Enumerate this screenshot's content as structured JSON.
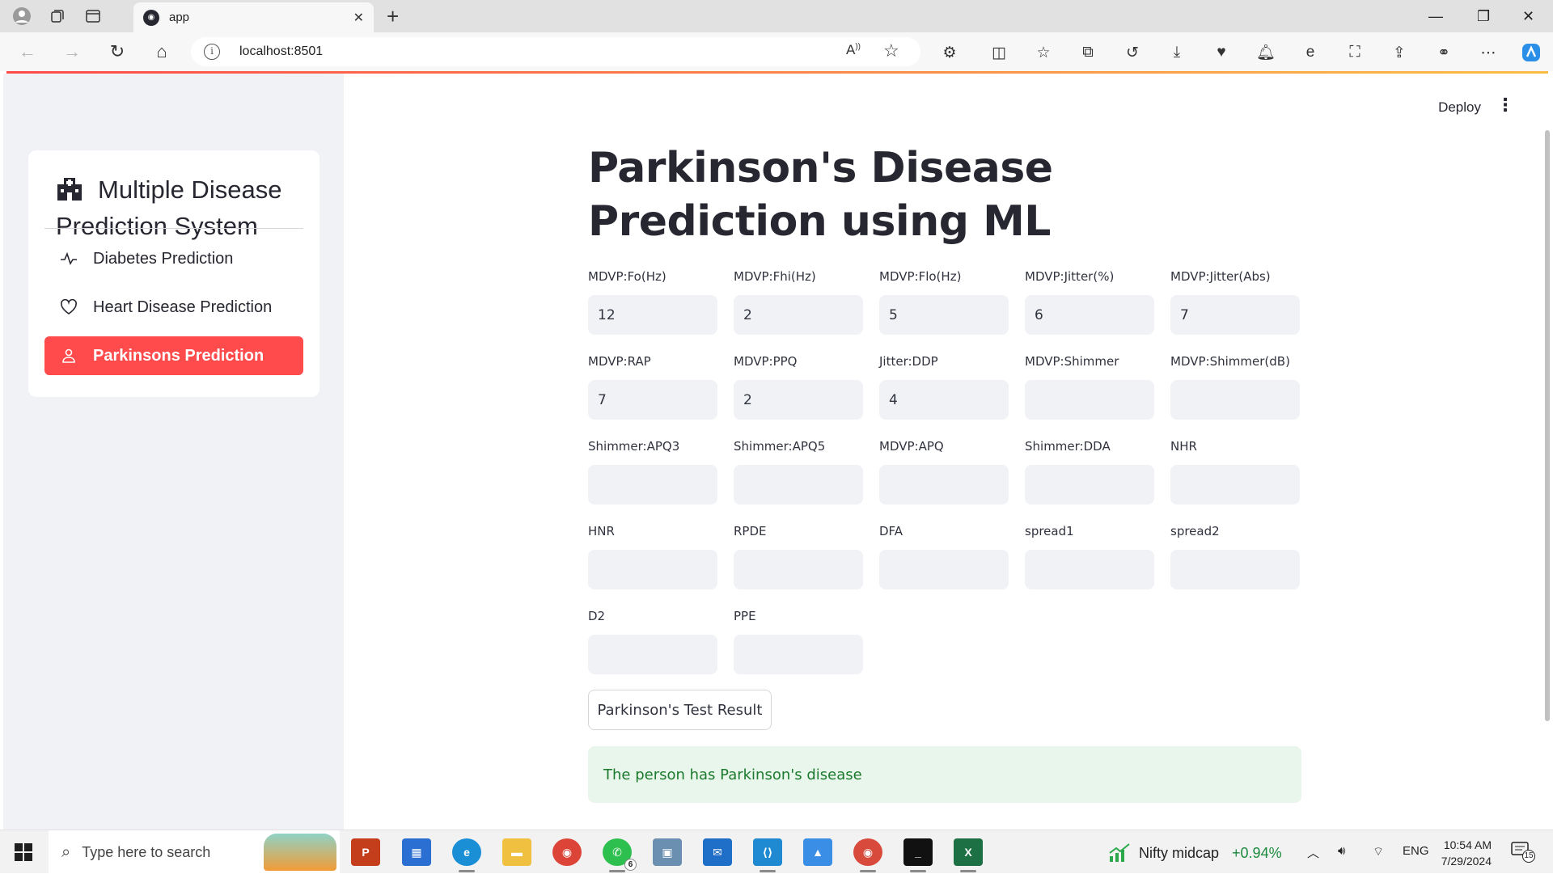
{
  "browser": {
    "tab_title": "app",
    "tab_favicon": "streamlit-logo",
    "url": "localhost:8501",
    "read_aloud_label": "A̅",
    "colors": {
      "progress_start": "#ff4b4b",
      "progress_end": "#ffbd45"
    }
  },
  "header": {
    "deploy_label": "Deploy",
    "menu_glyph": "⋮"
  },
  "sidebar": {
    "title": "Multiple Disease Prediction System",
    "title_icon": "hospital-icon",
    "items": [
      {
        "label": "Diabetes Prediction",
        "icon": "activity-icon",
        "active": false
      },
      {
        "label": "Heart Disease Prediction",
        "icon": "heart-icon",
        "active": false
      },
      {
        "label": "Parkinsons Prediction",
        "icon": "person-icon",
        "active": true
      }
    ],
    "active_color": "#ff4b4b"
  },
  "main": {
    "title": "Parkinson's Disease Prediction using ML",
    "fields": [
      {
        "label": "MDVP:Fo(Hz)",
        "value": "12"
      },
      {
        "label": "MDVP:Fhi(Hz)",
        "value": "2"
      },
      {
        "label": "MDVP:Flo(Hz)",
        "value": "5"
      },
      {
        "label": "MDVP:Jitter(%)",
        "value": "6"
      },
      {
        "label": "MDVP:Jitter(Abs)",
        "value": "7"
      },
      {
        "label": "MDVP:RAP",
        "value": "7"
      },
      {
        "label": "MDVP:PPQ",
        "value": "2"
      },
      {
        "label": "Jitter:DDP",
        "value": "4"
      },
      {
        "label": "MDVP:Shimmer",
        "value": ""
      },
      {
        "label": "MDVP:Shimmer(dB)",
        "value": ""
      },
      {
        "label": "Shimmer:APQ3",
        "value": ""
      },
      {
        "label": "Shimmer:APQ5",
        "value": ""
      },
      {
        "label": "MDVP:APQ",
        "value": ""
      },
      {
        "label": "Shimmer:DDA",
        "value": ""
      },
      {
        "label": "NHR",
        "value": ""
      },
      {
        "label": "HNR",
        "value": ""
      },
      {
        "label": "RPDE",
        "value": ""
      },
      {
        "label": "DFA",
        "value": ""
      },
      {
        "label": "spread1",
        "value": ""
      },
      {
        "label": "spread2",
        "value": ""
      },
      {
        "label": "D2",
        "value": ""
      },
      {
        "label": "PPE",
        "value": ""
      }
    ],
    "submit_label": "Parkinson's Test Result",
    "result_message": "The person has Parkinson's disease",
    "result_color": "#1b7a2e"
  },
  "taskbar": {
    "search_placeholder": "Type here to search",
    "apps": [
      "powerpoint",
      "microsoft-store",
      "edge",
      "file-explorer",
      "chrome",
      "whatsapp",
      "photos",
      "mail",
      "vscode",
      "paint",
      "chrome-profile",
      "terminal",
      "excel"
    ],
    "whatsapp_badge": "6",
    "stock_name": "Nifty midcap",
    "stock_change": "+0.94%",
    "language": "ENG",
    "time": "10:54 AM",
    "date": "7/29/2024",
    "notification_count": "15"
  }
}
